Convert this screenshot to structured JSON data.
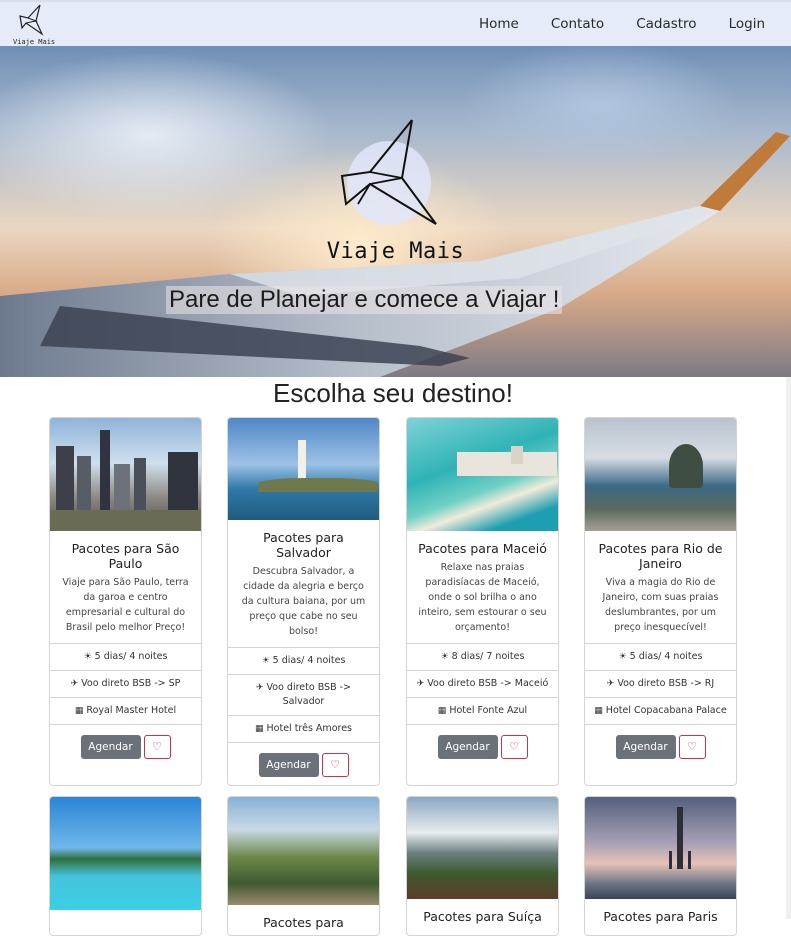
{
  "nav": {
    "brand": "Viaje Mais",
    "links": [
      "Home",
      "Contato",
      "Cadastro",
      "Login"
    ]
  },
  "hero": {
    "title": "Viaje Mais",
    "subtitle": "Pare de Planejar e comece a Viajar !"
  },
  "section": {
    "title": "Escolha seu destino!"
  },
  "cards": [
    {
      "title": "Pacotes para São Paulo",
      "desc": "Viaje para São Paulo, terra da garoa e centro empresarial e cultural do Brasil pelo melhor Preço!",
      "nights": "5 dias/ 4 noites",
      "flight": "Voo direto BSB -> SP",
      "hotel": "Royal Master Hotel",
      "button": "Agendar"
    },
    {
      "title": "Pacotes para Salvador",
      "desc": "Descubra Salvador, a cidade da alegria e berço da cultura baiana, por um preço que cabe no seu bolso!",
      "nights": "5 dias/ 4 noites",
      "flight": "Voo direto BSB -> Salvador",
      "hotel": "Hotel três Amores",
      "button": "Agendar"
    },
    {
      "title": "Pacotes para Maceió",
      "desc": "Relaxe nas praias paradisíacas de Maceió, onde o sol brilha o ano inteiro, sem estourar o seu orçamento!",
      "nights": "8 dias/ 7 noites",
      "flight": "Voo direto BSB -> Maceió",
      "hotel": "Hotel Fonte Azul",
      "button": "Agendar"
    },
    {
      "title": "Pacotes para Rio de Janeiro",
      "desc": "Viva a magia do Rio de Janeiro, com suas praias deslumbrantes, por um preço inesquecível!",
      "nights": "5 dias/ 4 noites",
      "flight": "Voo direto BSB -> RJ",
      "hotel": "Hotel Copacabana Palace",
      "button": "Agendar"
    }
  ],
  "cards_row2": [
    {
      "title": ""
    },
    {
      "title": "Pacotes para"
    },
    {
      "title": "Pacotes para Suíça"
    },
    {
      "title": "Pacotes para Paris"
    }
  ]
}
